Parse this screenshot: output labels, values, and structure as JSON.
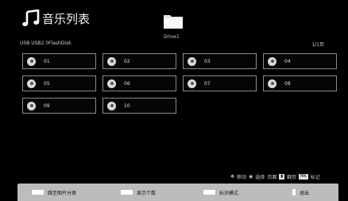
{
  "header": {
    "title": "音乐列表",
    "drive": "Drive1",
    "path": "USB USB2 0FlashDisk",
    "page": "1/1页"
  },
  "tracks": [
    "01",
    "02",
    "03",
    "04",
    "05",
    "06",
    "07",
    "08",
    "09",
    "10"
  ],
  "hints": {
    "move": "移动",
    "select": "选择",
    "page_label": "页面",
    "page_action": "翻页",
    "mark_key": "MK",
    "mark_label": "标记"
  },
  "bottombar": {
    "btn1": "跳至图片分类",
    "btn2": "显示个数",
    "btn3": "标识模式",
    "btn4": "退出"
  }
}
